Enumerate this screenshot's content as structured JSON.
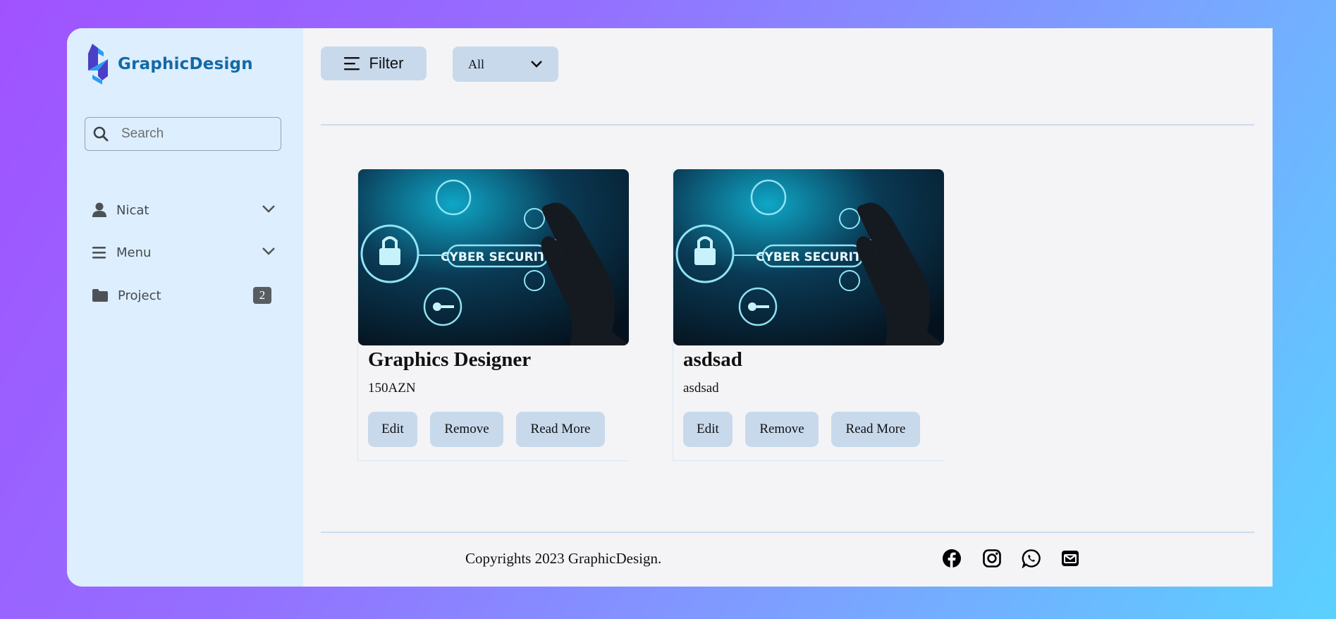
{
  "brand": {
    "name": "GraphicDesign"
  },
  "sidebar": {
    "search": {
      "placeholder": "Search",
      "value": ""
    },
    "items": [
      {
        "label": "Nicat",
        "icon": "user-icon",
        "expandable": true
      },
      {
        "label": "Menu",
        "icon": "hamburger-icon",
        "expandable": true
      },
      {
        "label": "Project",
        "icon": "folder-icon",
        "badge": "2"
      }
    ]
  },
  "toolbar": {
    "filter_label": "Filter",
    "select_value": "All"
  },
  "cards": [
    {
      "title": "Graphics Designer",
      "subtitle": "150AZN",
      "image_text": "CYBER SECURITY",
      "buttons": {
        "edit": "Edit",
        "remove": "Remove",
        "read_more": "Read More"
      }
    },
    {
      "title": "asdsad",
      "subtitle": "asdsad",
      "image_text": "CYBER SECURITY",
      "buttons": {
        "edit": "Edit",
        "remove": "Remove",
        "read_more": "Read More"
      }
    }
  ],
  "footer": {
    "copyright": "Copyrights 2023 GraphicDesign.",
    "social": [
      "facebook-icon",
      "instagram-icon",
      "whatsapp-icon",
      "email-icon"
    ]
  },
  "colors": {
    "brand": "#1469a6",
    "sidebar_bg": "#ddeefe",
    "button_bg": "#c8d9ec",
    "main_bg": "#f4f4f6",
    "badge_bg": "#585d62"
  }
}
